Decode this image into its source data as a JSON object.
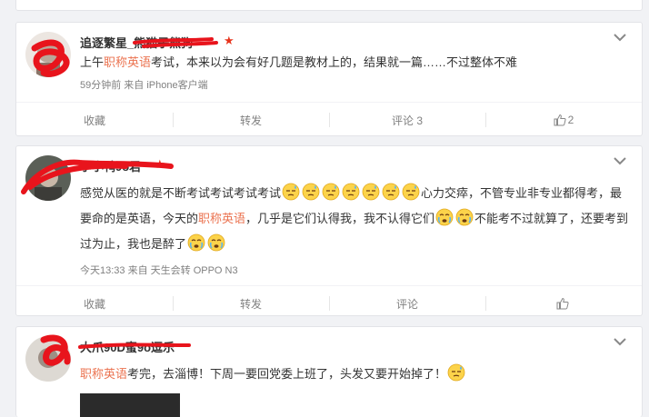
{
  "posts": [
    {
      "username": "追逐繁星_熊猫子熊狗",
      "text_before": "上午",
      "highlight": "职称英语",
      "text_after": "考试，本来以为会有好几题是教材上的，结果就一篇……不过整体不难",
      "meta": "59分钟前 来自 iPhone客户端",
      "actions": {
        "collect": "收藏",
        "repost": "转发",
        "comment": "评论 3",
        "like": "2"
      }
    },
    {
      "username": "小小鸭9o君",
      "text_part1": "感觉从医的就是不断考试考试考试考试",
      "emojis_a": [
        "sweat",
        "sweat",
        "sweat",
        "sweat",
        "sweat",
        "sweat",
        "sweat"
      ],
      "text_part2": "心力交瘁，不管专业非专业都得考，最要命的是英语，今天的",
      "highlight": "职称英语",
      "text_part3": "，几乎是它们认得我，我不认得它们",
      "emojis_b": [
        "cry",
        "cry"
      ],
      "text_part4": "不能考不过就算了，还要考到过为止，我也是醉了",
      "emojis_c": [
        "cry",
        "cry"
      ],
      "meta": "今天13:33 来自 天生会转 OPPO N3",
      "actions": {
        "collect": "收藏",
        "repost": "转发",
        "comment": "评论",
        "like": ""
      }
    },
    {
      "username": "大爪90D蜜9o逗乐",
      "highlight": "职称英语",
      "text_after": "考完，去淄博！下周一要回党委上班了，头发又要开始掉了！",
      "emojis": [
        "sweat"
      ]
    }
  ],
  "colors": {
    "highlight": "#eb7350",
    "vip_star": "#e7341c",
    "scribble": "#e8141c"
  }
}
